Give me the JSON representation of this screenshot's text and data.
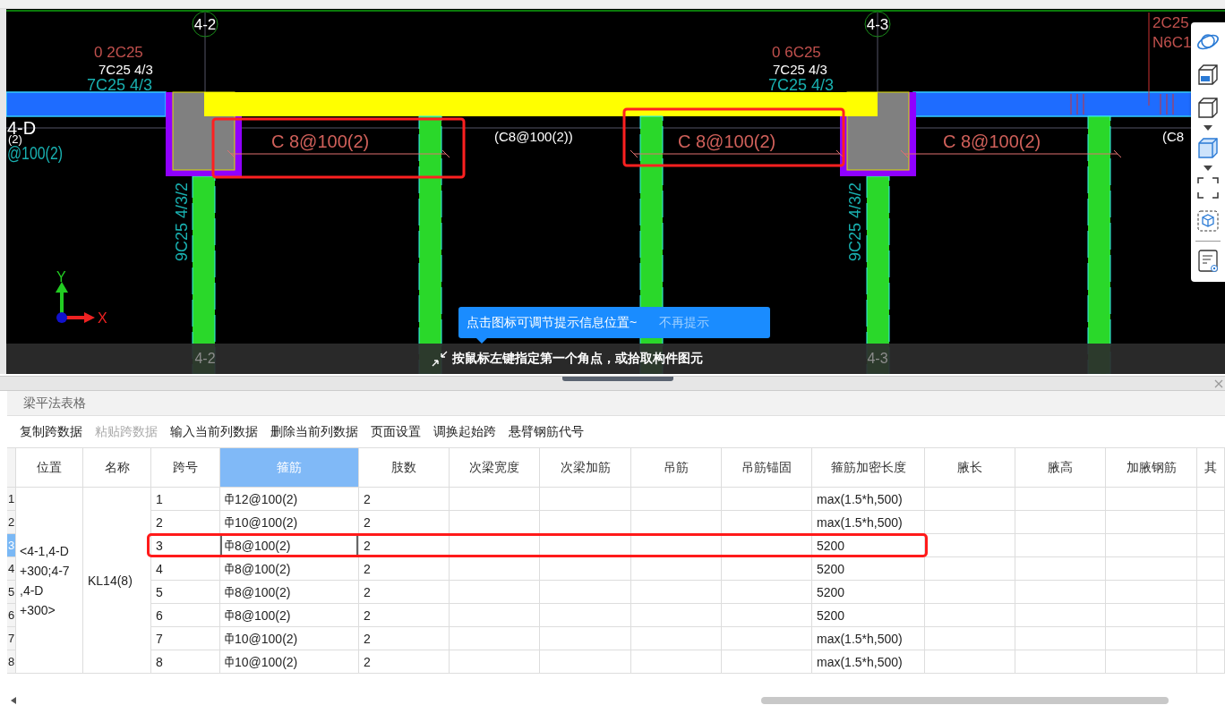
{
  "drawing": {
    "grid_labels_top": [
      "4-2",
      "4-3"
    ],
    "grid_labels_bottom": [
      "4-2",
      "4-3"
    ],
    "row_axis_label": "4-D",
    "left_edge_texts": [
      "(2)",
      "@100(2)"
    ],
    "top_rebar": [
      {
        "extra": "0 2C25",
        "original": "7C25 4/3",
        "current": "7C25 4/3"
      },
      {
        "extra": "0 6C25",
        "original": "7C25 4/3",
        "current": "7C25 4/3"
      }
    ],
    "stirrup_labels": [
      "C  8@100(2)",
      "C  8@100(2)",
      "C  8@100(2)"
    ],
    "original_stirrup_labels": [
      "(C8@100(2))",
      "(C8"
    ],
    "column_labels": [
      "9C25 4/3/2",
      "9C25 4/3/2"
    ],
    "corner_labels": [
      "2C25",
      "N6C1"
    ],
    "axes": [
      "Y",
      "X"
    ]
  },
  "tip": {
    "message": "点击图标可调节提示信息位置~",
    "dismiss": "不再提示"
  },
  "prompt": "按鼠标左键指定第一个角点，或拾取构件图元",
  "panel": {
    "title": "梁平法表格",
    "toolbar": [
      {
        "label": "复制跨数据",
        "disabled": false
      },
      {
        "label": "粘贴跨数据",
        "disabled": true
      },
      {
        "label": "输入当前列数据",
        "disabled": false
      },
      {
        "label": "删除当前列数据",
        "disabled": false
      },
      {
        "label": "页面设置",
        "disabled": false
      },
      {
        "label": "调换起始跨",
        "disabled": false
      },
      {
        "label": "悬臂钢筋代号",
        "disabled": false
      }
    ],
    "table": {
      "columns": [
        {
          "label": "位置",
          "selected": false
        },
        {
          "label": "名称",
          "selected": false
        },
        {
          "label": "跨号",
          "selected": false
        },
        {
          "label": "箍筋",
          "selected": true
        },
        {
          "label": "肢数",
          "selected": false
        },
        {
          "label": "次梁宽度",
          "selected": false
        },
        {
          "label": "次梁加筋",
          "selected": false
        },
        {
          "label": "吊筋",
          "selected": false
        },
        {
          "label": "吊筋锚固",
          "selected": false
        },
        {
          "label": "箍筋加密长度",
          "selected": false
        },
        {
          "label": "腋长",
          "selected": false
        },
        {
          "label": "腋高",
          "selected": false
        },
        {
          "label": "加腋钢筋",
          "selected": false
        },
        {
          "label": "其",
          "selected": false
        }
      ],
      "location_lines": [
        "<4-1,4-D",
        "+300;4-7",
        ",4-D",
        "+300>"
      ],
      "name": "KL14(8)",
      "rows": [
        {
          "number": "1",
          "span": "1",
          "stirrup": "12@100(2)",
          "legs": "2",
          "dense_length": "max(1.5*h,500)",
          "selected": false,
          "circled": false
        },
        {
          "number": "2",
          "span": "2",
          "stirrup": "10@100(2)",
          "legs": "2",
          "dense_length": "max(1.5*h,500)",
          "selected": false,
          "circled": false
        },
        {
          "number": "3",
          "span": "3",
          "stirrup": "8@100(2)",
          "legs": "2",
          "dense_length": "5200",
          "selected": true,
          "circled": true
        },
        {
          "number": "4",
          "span": "4",
          "stirrup": "8@100(2)",
          "legs": "2",
          "dense_length": "5200",
          "selected": false,
          "circled": false
        },
        {
          "number": "5",
          "span": "5",
          "stirrup": "8@100(2)",
          "legs": "2",
          "dense_length": "5200",
          "selected": false,
          "circled": false
        },
        {
          "number": "6",
          "span": "6",
          "stirrup": "8@100(2)",
          "legs": "2",
          "dense_length": "5200",
          "selected": false,
          "circled": false
        },
        {
          "number": "7",
          "span": "7",
          "stirrup": "10@100(2)",
          "legs": "2",
          "dense_length": "max(1.5*h,500)",
          "selected": false,
          "circled": false
        },
        {
          "number": "8",
          "span": "8",
          "stirrup": "10@100(2)",
          "legs": "2",
          "dense_length": "max(1.5*h,500)",
          "selected": false,
          "circled": false
        }
      ]
    }
  }
}
